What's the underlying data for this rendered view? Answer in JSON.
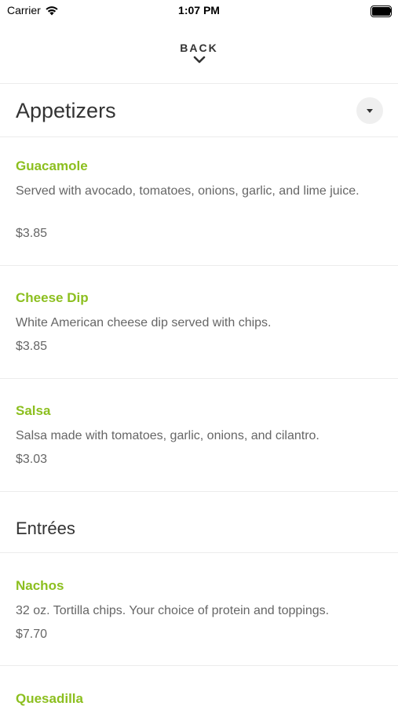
{
  "status_bar": {
    "carrier": "Carrier",
    "time": "1:07 PM",
    "wifi_icon": "wifi-icon",
    "battery_icon": "battery-full-icon"
  },
  "header": {
    "back_label": "BACK",
    "back_icon": "chevron-down-icon"
  },
  "colors": {
    "item_name": "#8cbf1f",
    "body_text": "#666666",
    "heading_text": "#333333",
    "divider": "#ececec"
  },
  "sections": [
    {
      "title": "Appetizers",
      "toggle_icon": "caret-down-icon",
      "items": [
        {
          "name": "Guacamole",
          "description": "Served with avocado, tomatoes, onions, garlic, and lime juice.",
          "price": "$3.85"
        },
        {
          "name": "Cheese Dip",
          "description": "White American cheese dip served with chips.",
          "price": "$3.85"
        },
        {
          "name": "Salsa",
          "description": "Salsa made with tomatoes, garlic, onions, and cilantro.",
          "price": "$3.03"
        }
      ]
    },
    {
      "title": "Entrées",
      "items": [
        {
          "name": "Nachos",
          "description": "32 oz. Tortilla chips. Your choice of protein and toppings.",
          "price": "$7.70"
        },
        {
          "name": "Quesadilla"
        }
      ]
    }
  ]
}
